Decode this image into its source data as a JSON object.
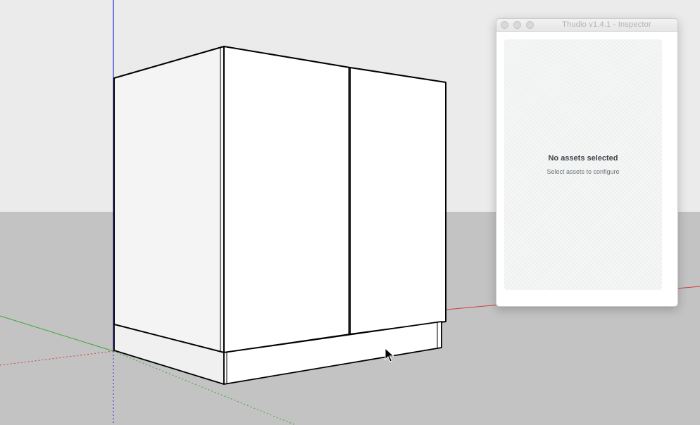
{
  "inspector": {
    "window_title": "Thudio v1.4.1 - Inspector",
    "empty_title": "No assets selected",
    "empty_subtitle": "Select assets to configure"
  },
  "icons": {
    "close": "window-close-icon",
    "minimize": "window-minimize-icon",
    "zoom": "window-zoom-icon",
    "cursor": "mouse-pointer-icon"
  },
  "colors": {
    "sky": "#ebebeb",
    "ground": "#c3c3c3",
    "axis_blue": "#2a2ad6",
    "axis_red": "#d23a3a",
    "axis_green": "#3aa83a",
    "cabinet_face": "#ffffff",
    "cabinet_edge": "#000000"
  }
}
